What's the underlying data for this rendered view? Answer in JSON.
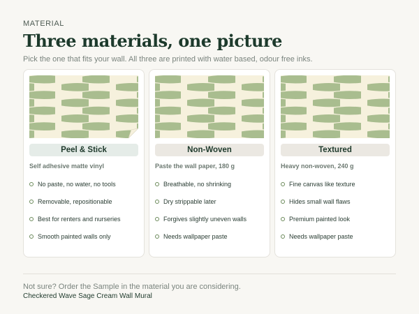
{
  "header": {
    "eyebrow": "MATERIAL",
    "title": "Three materials, one picture",
    "subtitle": "Pick the one that fits your wall. All three are printed with water based, odour free inks."
  },
  "colors": {
    "sage": "#a4b98a",
    "cream": "#f6f1dd",
    "title_green": "#1d3a2c",
    "peel_pill": "#e5ece8",
    "neutral_pill": "#ebe8e2"
  },
  "cards": [
    {
      "name": "Peel & Stick",
      "description": "Self adhesive matte vinyl",
      "features": [
        "No paste, no water, no tools",
        "Removable, repositionable",
        "Best for renters and nurseries",
        "Smooth painted walls only"
      ]
    },
    {
      "name": "Non-Woven",
      "description": "Paste the wall paper, 180 g",
      "features": [
        "Breathable, no shrinking",
        "Dry strippable later",
        "Forgives slightly uneven walls",
        "Needs wallpaper paste"
      ]
    },
    {
      "name": "Textured",
      "description": "Heavy non-woven, 240 g",
      "features": [
        "Fine canvas like texture",
        "Hides small wall flaws",
        "Premium painted look",
        "Needs wallpaper paste"
      ]
    }
  ],
  "footer": {
    "note": "Not sure? Order the Sample in the material you are considering.",
    "product": "Checkered Wave Sage Cream Wall Mural"
  }
}
